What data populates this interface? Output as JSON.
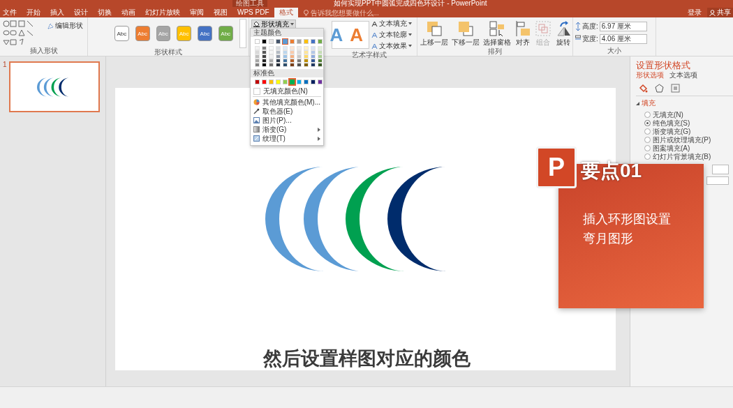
{
  "window": {
    "title": "如何实现PPT中圆弧完成四色环设计 - PowerPoint",
    "context_tab": "绘图工具",
    "sign_in": "登录",
    "share": "共享"
  },
  "tabs": [
    {
      "label": "文件",
      "selected": false
    },
    {
      "label": "开始",
      "selected": false
    },
    {
      "label": "插入",
      "selected": false
    },
    {
      "label": "设计",
      "selected": false
    },
    {
      "label": "切换",
      "selected": false
    },
    {
      "label": "动画",
      "selected": false
    },
    {
      "label": "幻灯片放映",
      "selected": false
    },
    {
      "label": "审阅",
      "selected": false
    },
    {
      "label": "视图",
      "selected": false
    },
    {
      "label": "WPS PDF",
      "selected": false
    },
    {
      "label": "格式",
      "selected": true
    }
  ],
  "tell_me": {
    "placeholder": "告诉我您想要做什么..."
  },
  "ribbon": {
    "insert_shapes": {
      "label": "插入形状",
      "edit_shape": "编辑形状"
    },
    "shape_styles": {
      "label": "形状样式",
      "styles": [
        {
          "label": "Abc",
          "color": "#ffffff"
        },
        {
          "label": "Abc",
          "color": "#ed7d31"
        },
        {
          "label": "Abc",
          "color": "#a5a5a5"
        },
        {
          "label": "Abc",
          "color": "#ffc000"
        },
        {
          "label": "Abc",
          "color": "#4472c4"
        },
        {
          "label": "Abc",
          "color": "#70ad47"
        }
      ],
      "shape_fill": "形状填充"
    },
    "wordart_styles": {
      "label": "艺术字样式",
      "styles": [
        {
          "label": "A",
          "color": "#5b9bd5"
        },
        {
          "label": "A",
          "color": "#ed7d31"
        }
      ],
      "text_fill": "文本填充",
      "text_outline": "文本轮廓",
      "text_effects": "文本效果"
    },
    "arrange": {
      "label": "排列",
      "buttons": [
        {
          "label": "上移一层",
          "kind": "forward",
          "disabled": false
        },
        {
          "label": "下移一层",
          "kind": "backward",
          "disabled": false
        },
        {
          "label": "选择窗格",
          "kind": "pane",
          "disabled": false
        },
        {
          "label": "对齐",
          "kind": "align",
          "disabled": false
        },
        {
          "label": "组合",
          "kind": "group",
          "disabled": true
        },
        {
          "label": "旋转",
          "kind": "rotate",
          "disabled": false
        }
      ]
    },
    "size": {
      "label": "大小",
      "height_label": "高度:",
      "height": "6.97 厘米",
      "width_label": "宽度:",
      "width": "4.06 厘米"
    }
  },
  "fill_menu": {
    "theme_title": "主题颜色",
    "theme_colors": [
      {
        "color": "#ffffff",
        "selected": false
      },
      {
        "color": "#000000",
        "selected": false
      },
      {
        "color": "#e7e6e6",
        "selected": false
      },
      {
        "color": "#44546a",
        "selected": false
      },
      {
        "color": "#5b9bd5",
        "selected": true
      },
      {
        "color": "#ed7d31",
        "selected": false
      },
      {
        "color": "#a5a5a5",
        "selected": false
      },
      {
        "color": "#ffc000",
        "selected": false
      },
      {
        "color": "#4472c4",
        "selected": false
      },
      {
        "color": "#70ad47",
        "selected": false
      }
    ],
    "standard_title": "标准色",
    "standard_colors": [
      {
        "color": "#c00000",
        "hovered": false
      },
      {
        "color": "#ff0000",
        "hovered": false
      },
      {
        "color": "#ffc000",
        "hovered": false
      },
      {
        "color": "#ffff00",
        "hovered": false
      },
      {
        "color": "#92d050",
        "hovered": false
      },
      {
        "color": "#00b050",
        "hovered": true
      },
      {
        "color": "#00b0f0",
        "hovered": false
      },
      {
        "color": "#0070c0",
        "hovered": false
      },
      {
        "color": "#002060",
        "hovered": false
      },
      {
        "color": "#7030a0",
        "hovered": false
      }
    ],
    "items": [
      {
        "label": "无填充颜色(N)",
        "kind": "none",
        "submenu": false
      },
      {
        "label": "其他填充颜色(M)...",
        "kind": "palette",
        "submenu": false
      },
      {
        "label": "取色器(E)",
        "kind": "eyedropper",
        "submenu": false
      },
      {
        "label": "图片(P)...",
        "kind": "picture",
        "submenu": false
      },
      {
        "label": "渐变(G)",
        "kind": "gradient",
        "submenu": true
      },
      {
        "label": "纹理(T)",
        "kind": "texture",
        "submenu": true
      }
    ]
  },
  "thumbnails": [
    {
      "number": "1",
      "selected": true
    }
  ],
  "slide": {
    "crescents": [
      {
        "color": "#5b9bd5"
      },
      {
        "color": "#5b9bd5"
      },
      {
        "color": "#00a050"
      },
      {
        "color": "#002c6c"
      }
    ]
  },
  "overlay": {
    "logo": "P",
    "heading": "要点01",
    "lines": [
      "插入环形图设置",
      "弯月图形"
    ],
    "subtitle": "然后设置样图对应的颜色"
  },
  "format_pane": {
    "title": "设置形状格式",
    "tabs": [
      {
        "label": "形状选项",
        "selected": true
      },
      {
        "label": "文本选项",
        "selected": false
      }
    ],
    "section": "填充",
    "options": [
      {
        "label": "无填充(N)",
        "selected": false
      },
      {
        "label": "纯色填充(S)",
        "selected": true
      },
      {
        "label": "渐变填充(G)",
        "selected": false
      },
      {
        "label": "图片或纹理填充(P)",
        "selected": false
      },
      {
        "label": "图案填充(A)",
        "selected": false
      },
      {
        "label": "幻灯片背景填充(B)",
        "selected": false
      }
    ]
  }
}
